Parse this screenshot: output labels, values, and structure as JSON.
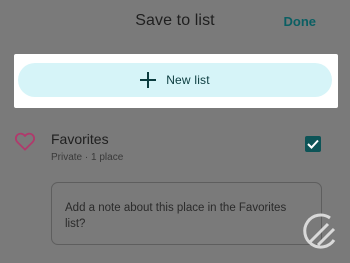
{
  "header": {
    "title": "Save to list",
    "done_label": "Done"
  },
  "new_list": {
    "label": "New list",
    "icon": "plus-icon"
  },
  "list_item": {
    "icon": "heart-icon",
    "title": "Favorites",
    "subtitle": "Private · 1 place",
    "checked": true
  },
  "note": {
    "placeholder": "Add a note about this place in the Favorites list?"
  },
  "colors": {
    "accent": "#0b5f63",
    "button_bg": "#d6f4f8",
    "checkbox": "#0d5457",
    "heart": "#b03a6c",
    "overlay": "#7a7a7a"
  }
}
